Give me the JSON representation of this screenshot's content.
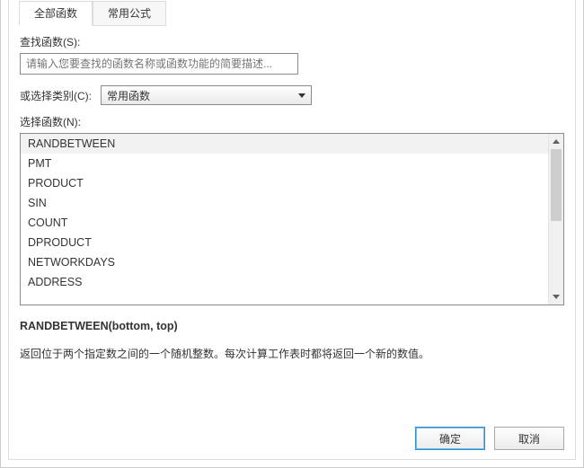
{
  "tabs": {
    "all_functions": "全部函数",
    "common_formulas": "常用公式"
  },
  "search": {
    "label": "查找函数(S):",
    "placeholder": "请输入您要查找的函数名称或函数功能的简要描述..."
  },
  "category": {
    "label": "或选择类别(C):",
    "selected": "常用函数"
  },
  "select_function_label": "选择函数(N):",
  "functions": {
    "items": [
      "RANDBETWEEN",
      "PMT",
      "PRODUCT",
      "SIN",
      "COUNT",
      "DPRODUCT",
      "NETWORKDAYS",
      "ADDRESS"
    ]
  },
  "description": {
    "syntax": "RANDBETWEEN(bottom, top)",
    "text": "返回位于两个指定数之间的一个随机整数。每次计算工作表时都将返回一个新的数值。"
  },
  "buttons": {
    "ok": "确定",
    "cancel": "取消"
  }
}
